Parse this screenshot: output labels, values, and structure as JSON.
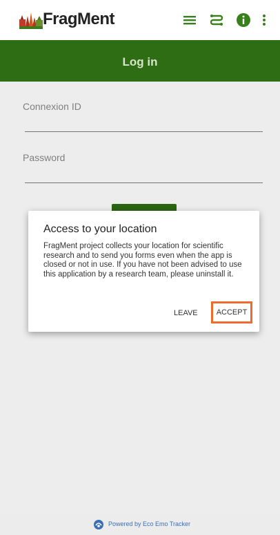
{
  "app": {
    "name": "FragMent"
  },
  "toolbar": {
    "icons": [
      "menu-icon",
      "route-icon",
      "info-icon",
      "more-vert-icon"
    ]
  },
  "page": {
    "title": "Log in"
  },
  "form": {
    "connexion_id_label": "Connexion ID",
    "password_label": "Password"
  },
  "dialog": {
    "title": "Access to your location",
    "message": "FragMent project collects your location for scientific research and to send you forms even when the app is closed or not in use. If you have not been advised to use this application by a research team, please uninstall it.",
    "leave_label": "LEAVE",
    "accept_label": "ACCEPT"
  },
  "footer": {
    "text": "Powered by Eco Emo Tracker"
  },
  "colors": {
    "brand_green": "#2e6d13",
    "highlight_orange": "#ee6b2c",
    "footer_link": "#3b6fb5"
  }
}
